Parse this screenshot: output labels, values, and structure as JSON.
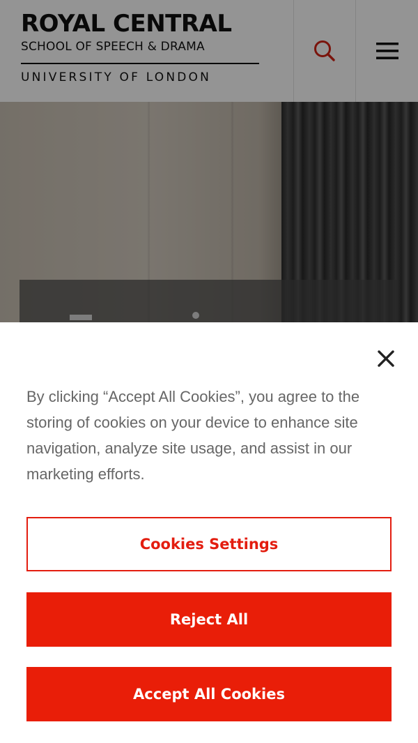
{
  "header": {
    "logo": {
      "line1": "ROYAL CENTRAL",
      "line2": "SCHOOL OF SPEECH & DRAMA",
      "line3": "UNIVERSITY OF LONDON"
    },
    "search_icon": "search-icon",
    "menu_icon": "hamburger-menu-icon"
  },
  "cookie_banner": {
    "text": "By clicking “Accept All Cookies”, you agree to the storing of cookies on your device to enhance site navigation, analyze site usage, and assist in our marketing efforts.",
    "close_icon": "close-icon",
    "settings_label": "Cookies Settings",
    "reject_label": "Reject All",
    "accept_label": "Accept All Cookies"
  },
  "colors": {
    "accent": "#e91e08",
    "text": "#666666"
  }
}
